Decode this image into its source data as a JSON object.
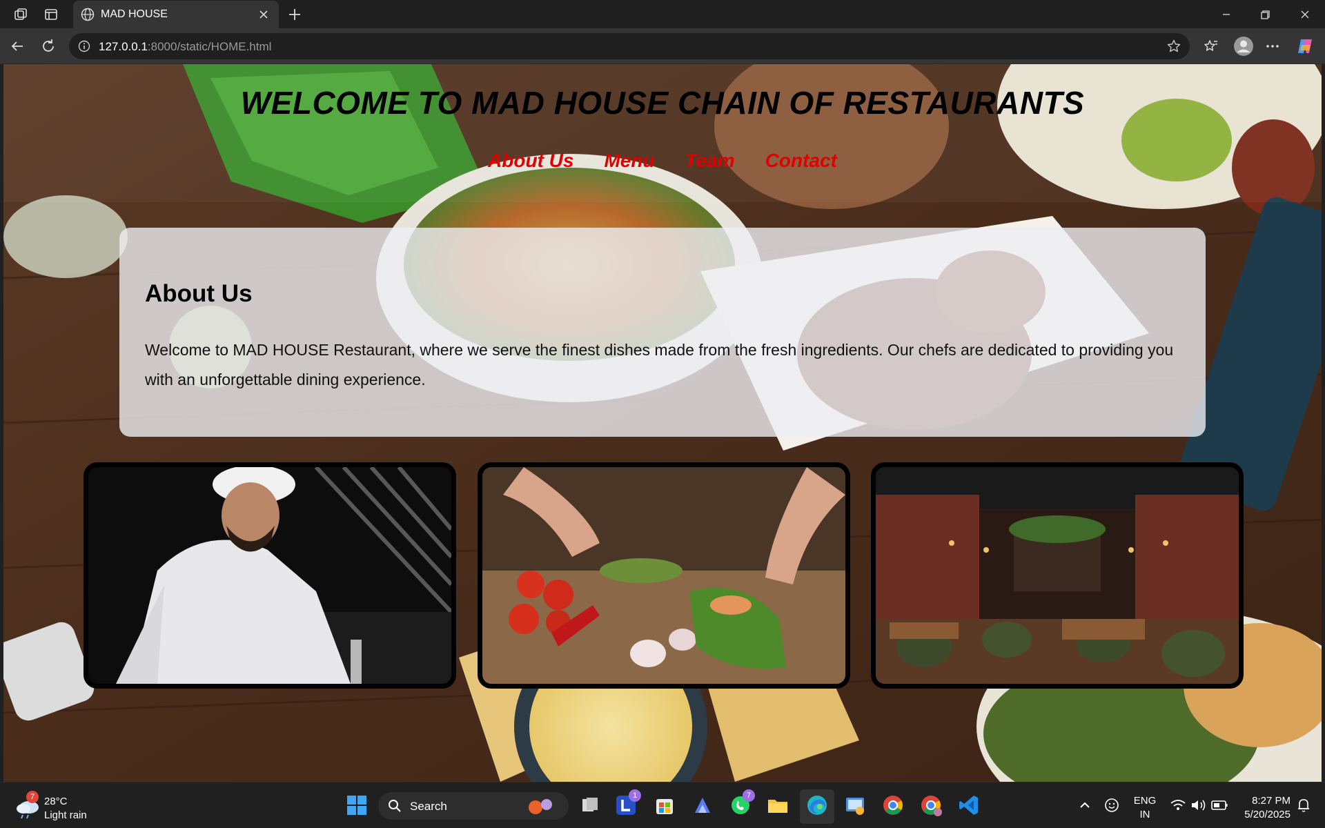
{
  "browser": {
    "tab_title": "MAD HOUSE",
    "url_host": "127.0.0.1",
    "url_rest": ":8000/static/HOME.html"
  },
  "site": {
    "title": "WELCOME TO MAD HOUSE CHAIN OF RESTAURANTS",
    "nav": [
      "About Us",
      "Menu",
      "Team",
      "Contact"
    ],
    "about_heading": "About Us",
    "about_text": "Welcome to MAD HOUSE Restaurant, where we serve the finest dishes made from the fresh ingredients. Our chefs are dedicated to providing you with an unforgettable dining experience.",
    "photos": [
      "chef-cooking-photo",
      "fresh-ingredients-photo",
      "restaurant-interior-photo"
    ]
  },
  "taskbar": {
    "weather_badge": "7",
    "temperature": "28°C",
    "weather": "Light rain",
    "search_label": "Search",
    "l_app_badge": "1",
    "whatsapp_badge": "7",
    "lang_1": "ENG",
    "lang_2": "IN",
    "time": "8:27 PM",
    "date": "5/20/2025"
  },
  "colors": {
    "nav_link": "#e00000",
    "title": "#000000",
    "card_bg": "#eeeef2"
  }
}
